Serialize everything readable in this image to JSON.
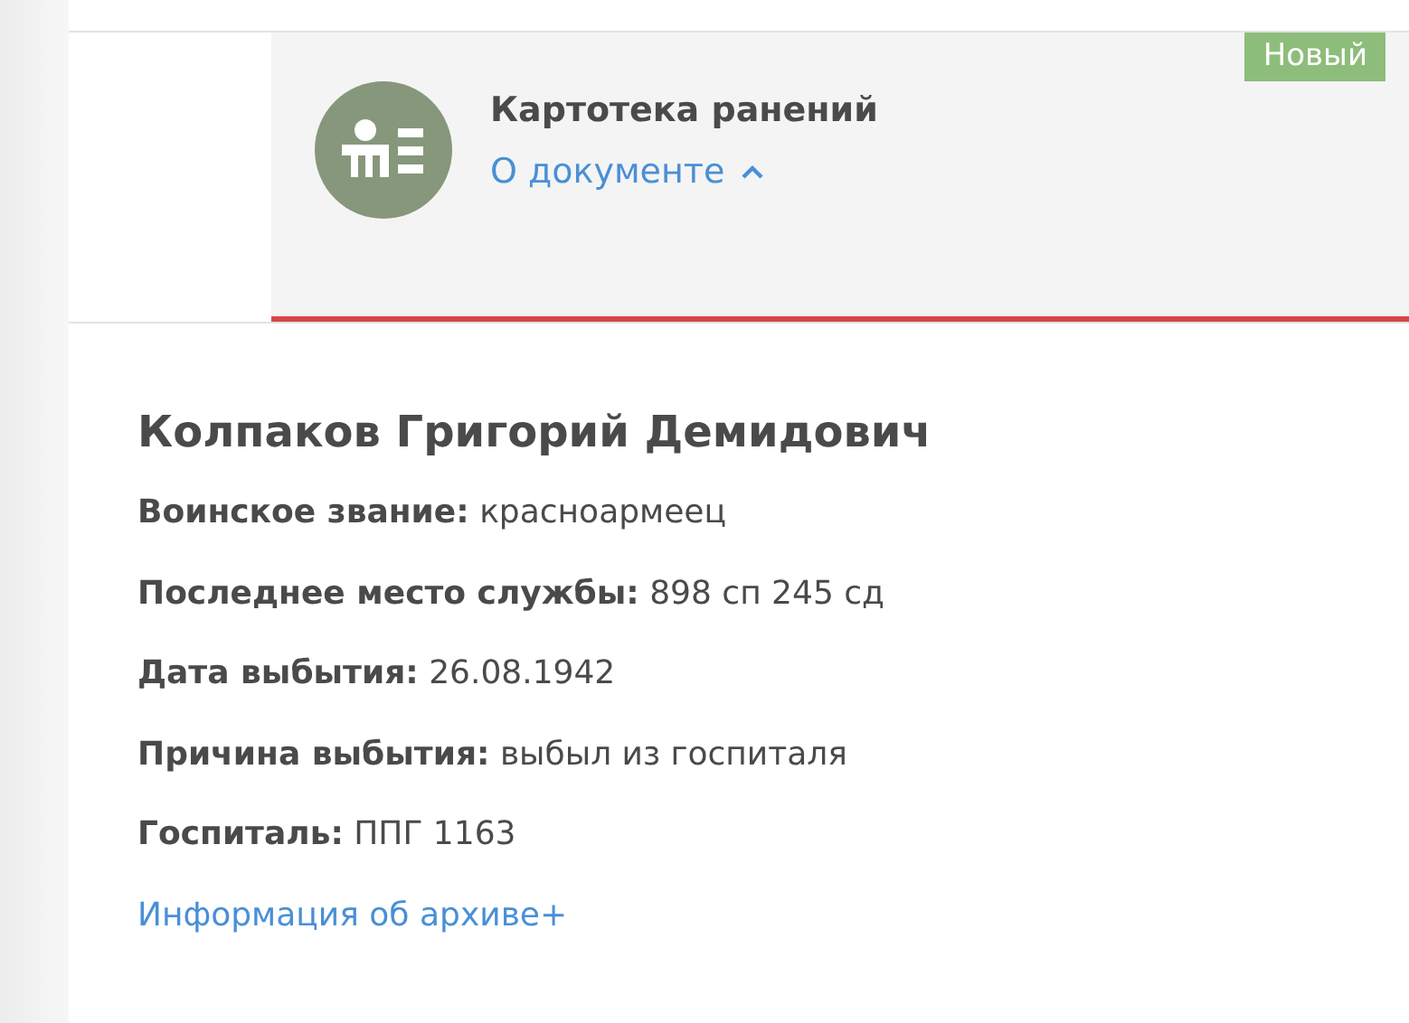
{
  "document_card": {
    "title": "Картотека ранений",
    "badge": "Новый",
    "about_link": {
      "label": "О документе",
      "expanded": true
    }
  },
  "person": {
    "name": "Колпаков Григорий Демидович",
    "fields": [
      {
        "label": "Воинское звание:",
        "value": "красноармеец"
      },
      {
        "label": "Последнее место службы:",
        "value": "898 сп 245 сд"
      },
      {
        "label": "Дата выбытия:",
        "value": "26.08.1942"
      },
      {
        "label": "Причина выбытия:",
        "value": "выбыл из госпиталя"
      },
      {
        "label": "Госпиталь:",
        "value": "ППГ 1163"
      }
    ],
    "archive_link": "Информация об архиве+"
  }
}
